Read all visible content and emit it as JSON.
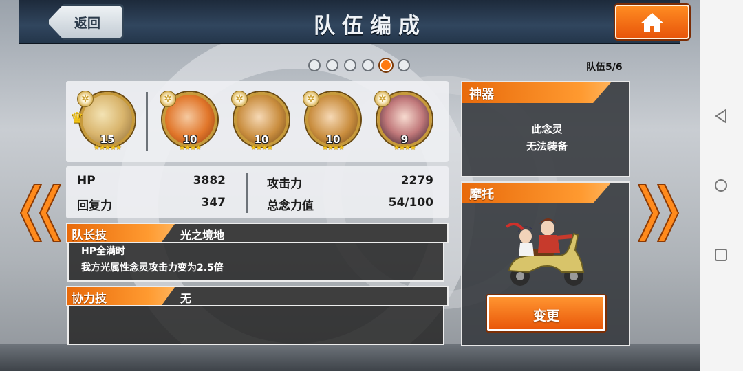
{
  "header": {
    "back_label": "返回",
    "title": "队伍编成",
    "home_icon": "home-icon"
  },
  "pager": {
    "total": 6,
    "active_index": 4,
    "team_label": "队伍5/6"
  },
  "members": [
    {
      "level": "15",
      "stars": "★★★★★",
      "leader": true
    },
    {
      "level": "10",
      "stars": "★★★★",
      "leader": false
    },
    {
      "level": "10",
      "stars": "★★★★",
      "leader": false
    },
    {
      "level": "10",
      "stars": "★★★★",
      "leader": false
    },
    {
      "level": "9",
      "stars": "★★★★",
      "leader": false
    }
  ],
  "stats": {
    "hp_label": "HP",
    "hp_value": "3882",
    "recovery_label": "回复力",
    "recovery_value": "347",
    "attack_label": "攻击力",
    "attack_value": "2279",
    "power_label": "总念力值",
    "power_value": "54/100"
  },
  "leader_skill": {
    "tab": "队长技",
    "name": "光之境地",
    "line1": "HP全满时",
    "line2": "我方光属性念灵攻击力变为2.5倍"
  },
  "coop_skill": {
    "tab": "协力技",
    "name": "无"
  },
  "artifact": {
    "tab": "神器",
    "line1": "此念灵",
    "line2": "无法装备"
  },
  "motor": {
    "tab": "摩托",
    "change_label": "变更"
  },
  "colors": {
    "accent_orange": "#ff8c22",
    "panel_dark": "#3e3e3e",
    "header_blue": "#31465e"
  }
}
